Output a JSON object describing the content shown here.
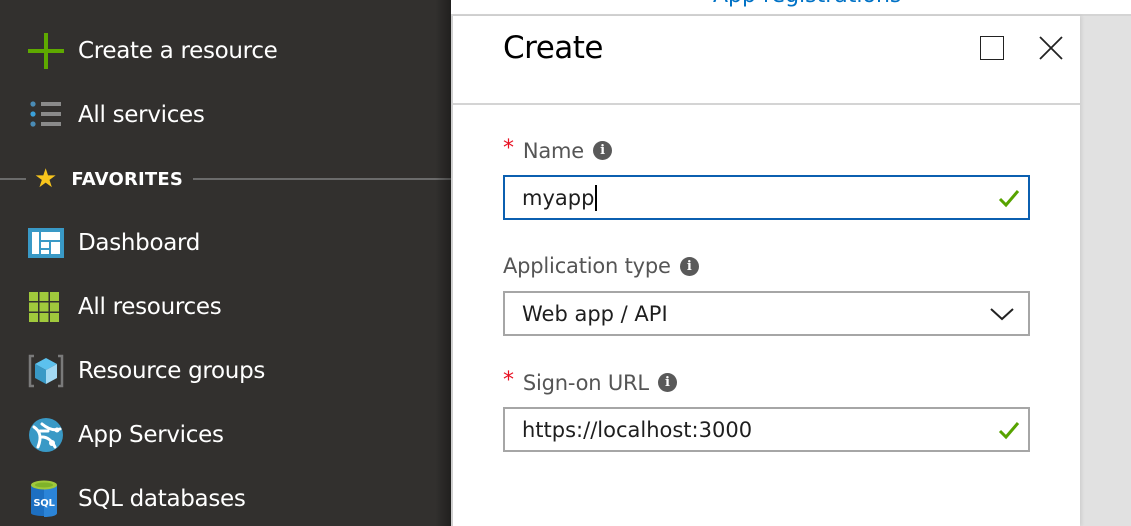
{
  "sidebar": {
    "items": [
      {
        "label": "Create a resource",
        "icon": "plus-icon"
      },
      {
        "label": "All services",
        "icon": "list-icon"
      }
    ],
    "favorites": {
      "label": "FAVORITES",
      "icon": "star-icon",
      "items": [
        {
          "label": "Dashboard",
          "icon": "dashboard-icon"
        },
        {
          "label": "All resources",
          "icon": "grid-icon"
        },
        {
          "label": "Resource groups",
          "icon": "cube-icon"
        },
        {
          "label": "App Services",
          "icon": "app-services-icon"
        },
        {
          "label": "SQL databases",
          "icon": "sql-database-icon"
        }
      ]
    }
  },
  "background": {
    "partial_link_text": "App registrations"
  },
  "panel": {
    "title": "Create",
    "maximize_icon": "maximize-icon",
    "close_icon": "close-icon",
    "fields": {
      "name": {
        "label": "Name",
        "required": "*",
        "value": "myapp",
        "valid": true
      },
      "application_type": {
        "label": "Application type",
        "selected": "Web app / API"
      },
      "sign_on_url": {
        "label": "Sign-on URL",
        "required": "*",
        "value": "https://localhost:3000",
        "valid": true
      }
    }
  },
  "colors": {
    "sidebar_bg": "#32302e",
    "accent_blue": "#0b5fb0",
    "required_red": "#e81123",
    "valid_green": "#57a300",
    "favorites_star": "#f8c51c"
  }
}
